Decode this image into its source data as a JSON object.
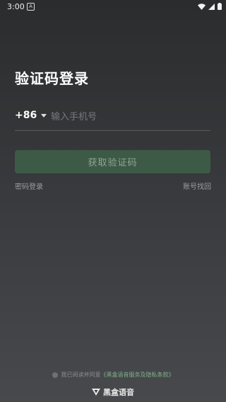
{
  "status_bar": {
    "time": "3:00",
    "notification_icon": "A"
  },
  "login": {
    "title": "验证码登录",
    "country_code": "+86",
    "phone_placeholder": "输入手机号",
    "get_code_label": "获取验证码",
    "password_login_label": "密码登录",
    "recover_account_label": "账号找回"
  },
  "agreement": {
    "prefix": "我已阅读并同意",
    "link": "《黑盒语音服务及隐私条款》"
  },
  "brand": {
    "name": "黑盒语音"
  },
  "colors": {
    "button_bg": "#3d5a46",
    "button_text": "#8ea596",
    "link_green": "#7fb08c"
  }
}
